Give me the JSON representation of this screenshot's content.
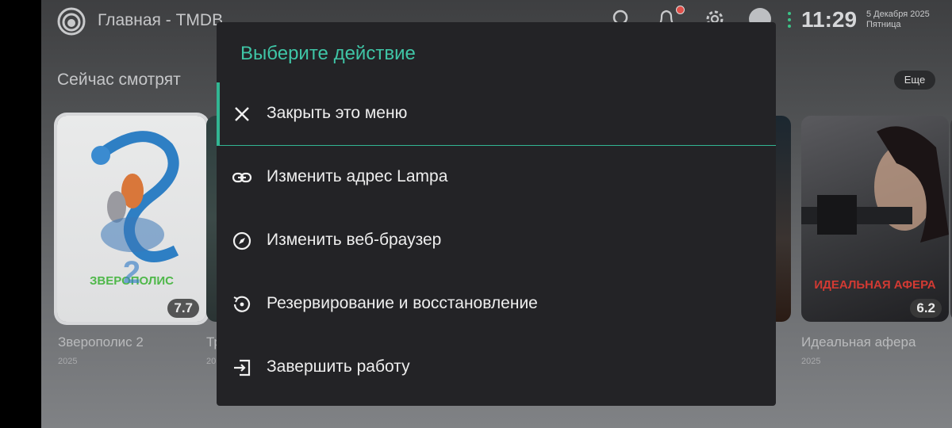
{
  "header": {
    "title": "Главная - TMDB",
    "time": "11:29",
    "date": "5 Декабря 2025",
    "weekday": "Пятница",
    "icons": [
      "logo-icon",
      "search-icon",
      "bell-icon",
      "settings-icon",
      "profile-icon"
    ]
  },
  "section": {
    "title": "Сейчас смотрят",
    "more_label": "Еще"
  },
  "cards": [
    {
      "title": "Зверополис 2",
      "year": "2025",
      "rating": "7.7",
      "poster_text_1": "ЗВЕРОПОЛИС",
      "poster_text_2": "2"
    },
    {
      "title": "Тр",
      "year": "20"
    },
    {
      "title": "Идеальная афера",
      "year": "2025",
      "rating": "6.2",
      "poster_text": "ИДЕАЛЬНАЯ АФЕРА"
    }
  ],
  "modal": {
    "title": "Выберите действие",
    "items": [
      {
        "label": "Закрыть это меню",
        "icon": "close-icon"
      },
      {
        "label": "Изменить адрес Lampa",
        "icon": "link-icon"
      },
      {
        "label": "Изменить веб-браузер",
        "icon": "compass-icon"
      },
      {
        "label": "Резервирование и восстановление",
        "icon": "restore-icon"
      },
      {
        "label": "Завершить работу",
        "icon": "exit-icon"
      }
    ]
  },
  "colors": {
    "accent": "#3fc5a6",
    "modal_bg": "#232326",
    "notification_dot": "#e0504a"
  }
}
